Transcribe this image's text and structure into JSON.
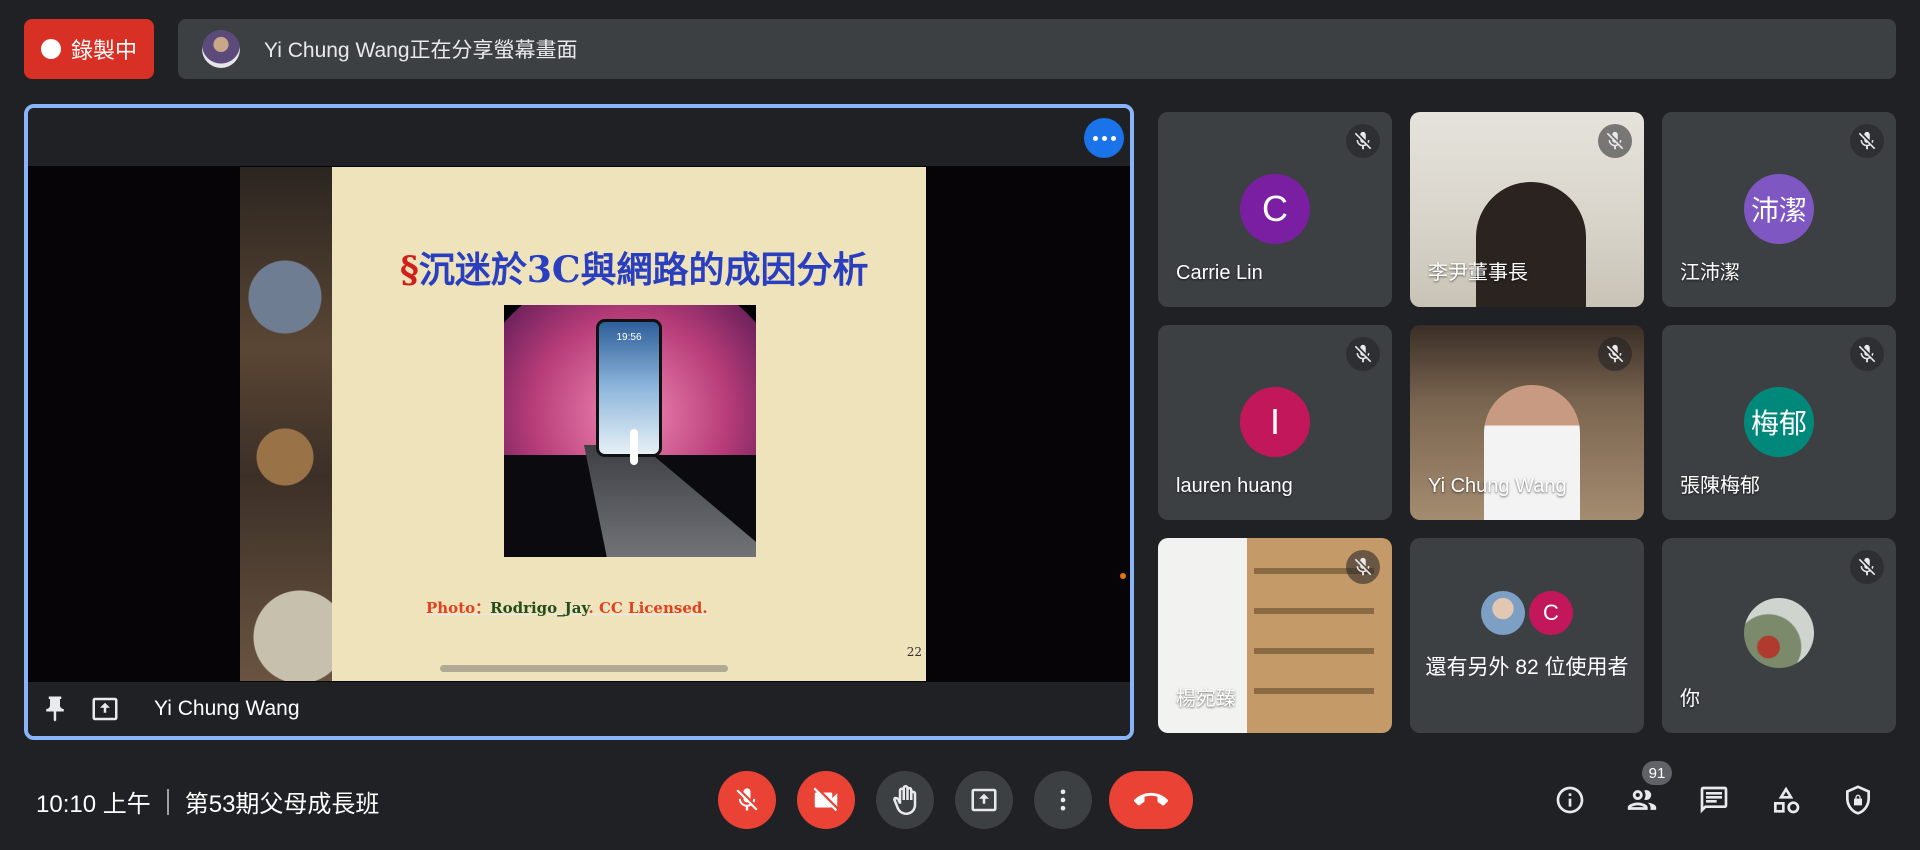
{
  "recording": {
    "label": "錄製中"
  },
  "banner": {
    "text": "Yi Chung Wang正在分享螢幕畫面"
  },
  "presentation": {
    "presenter_name": "Yi Chung Wang",
    "slide": {
      "title_section_mark": "§",
      "title": "沉迷於3C與網路的成因分析",
      "phone_time": "19:56",
      "caption_photo": "Photo：",
      "caption_author": "Rodrigo_Jay",
      "caption_license": ". CC Licensed.",
      "page_number": "22"
    }
  },
  "participants": [
    {
      "name": "Carrie Lin",
      "initial": "C",
      "color": "#7b1fa2",
      "video": false,
      "muted": true
    },
    {
      "name": "李尹董事長",
      "video": true,
      "muted": true
    },
    {
      "name": "江沛潔",
      "initial": "沛潔",
      "color": "#7e57c2",
      "video": false,
      "muted": true
    },
    {
      "name": "lauren huang",
      "initial": "I",
      "color": "#c2185b",
      "video": false,
      "muted": true
    },
    {
      "name": "Yi Chung Wang",
      "video": true,
      "muted": true
    },
    {
      "name": "張陳梅郁",
      "initial": "梅郁",
      "color": "#00897b",
      "video": false,
      "muted": true
    },
    {
      "name": "楊宛臻",
      "video": true,
      "muted": true
    },
    {
      "more_label": "還有另外 82 位使用者",
      "mini_initial": "C"
    },
    {
      "name": "你",
      "video": false,
      "muted": true
    }
  ],
  "footer": {
    "time": "10:10 上午",
    "meeting_name": "第53期父母成長班",
    "participant_count": "91"
  },
  "colors": {
    "accent_blue": "#1a73e8",
    "highlight_border": "#8ab4f8",
    "danger_red": "#ea4335",
    "background": "#202124",
    "surface": "#3c4043"
  }
}
